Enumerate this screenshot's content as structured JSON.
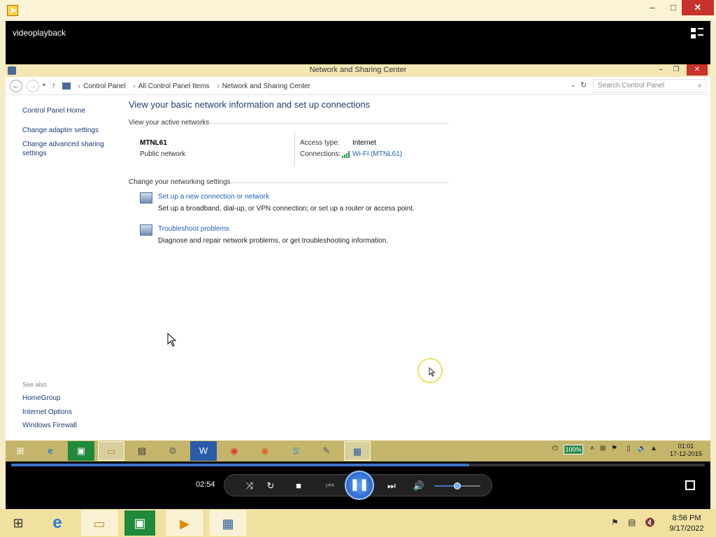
{
  "player": {
    "title": "videoplayback",
    "elapsed": "02:54",
    "progress_fraction": 0.66,
    "volume_fraction": 0.5
  },
  "explorer": {
    "window_title": "Network and Sharing Center",
    "breadcrumb": [
      "Control Panel",
      "All Control Panel Items",
      "Network and Sharing Center"
    ],
    "search_placeholder": "Search Control Panel",
    "left_links": [
      "Control Panel Home",
      "Change adapter settings",
      "Change advanced sharing settings"
    ],
    "see_also_label": "See also",
    "see_also_links": [
      "HomeGroup",
      "Internet Options",
      "Windows Firewall"
    ],
    "main_title": "View your basic network information and set up connections",
    "active_networks_label": "View your active networks",
    "network": {
      "name": "MTNL61",
      "type": "Public network",
      "access_type_label": "Access type:",
      "access_type_value": "Internet",
      "connections_label": "Connections:",
      "connections_value": "Wi-Fi (MTNL61)"
    },
    "change_settings_label": "Change your networking settings",
    "tasks": [
      {
        "title": "Set up a new connection or network",
        "desc": "Set up a broadband, dial-up, or VPN connection; or set up a router or access point."
      },
      {
        "title": "Troubleshoot problems",
        "desc": "Diagnose and repair network problems, or get troubleshooting information."
      }
    ]
  },
  "inner_taskbar": {
    "battery": "100%",
    "time": "01:01",
    "date": "17-12-2015"
  },
  "outer_taskbar": {
    "time": "8:56 PM",
    "date": "9/17/2022"
  }
}
